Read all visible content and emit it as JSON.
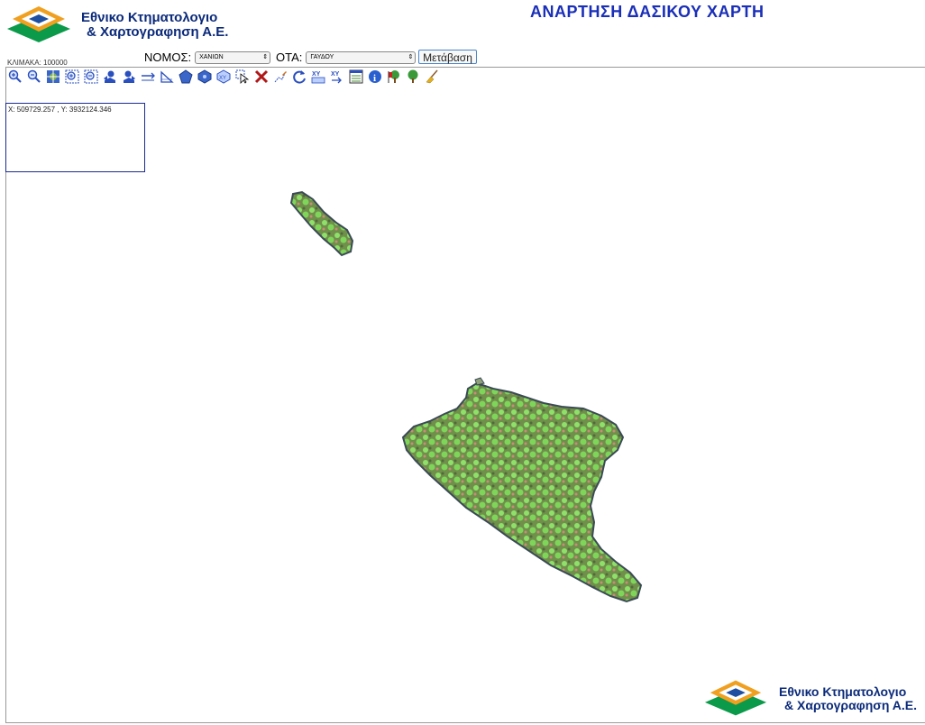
{
  "header": {
    "logo_line1": "Εθνικο Κτηματολογιο",
    "logo_line2": "& Χαρτογραφηση Α.Ε.",
    "title": "ΑΝΑΡΤΗΣΗ ΔΑΣΙΚΟΥ ΧΑΡΤΗ"
  },
  "controls": {
    "scale_label": "ΚΛΙΜΑΚΑ: 100000",
    "nomos_label": "ΝΟΜΟΣ:",
    "nomos_value": "ΧΑΝΙΩΝ",
    "ota_label": "ΟΤΑ:",
    "ota_value": "ΓΑΥΔΟΥ",
    "go_label": "Μετάβαση"
  },
  "toolbar": {
    "tools": [
      {
        "name": "zoom-in-icon"
      },
      {
        "name": "zoom-out-icon"
      },
      {
        "name": "full-extent-icon"
      },
      {
        "name": "zoom-box-in-icon"
      },
      {
        "name": "zoom-box-out-icon"
      },
      {
        "name": "pan-back-icon"
      },
      {
        "name": "pan-forward-icon"
      },
      {
        "name": "measure-distance-icon"
      },
      {
        "name": "measure-angle-icon"
      },
      {
        "name": "polygon-icon"
      },
      {
        "name": "polygon-select-icon"
      },
      {
        "name": "pointer-select-icon"
      },
      {
        "name": "clear-selection-icon"
      },
      {
        "name": "digitize-icon"
      },
      {
        "name": "refresh-icon"
      },
      {
        "name": "xy-goto-icon"
      },
      {
        "name": "xy-locate-icon"
      },
      {
        "name": "legend-icon"
      },
      {
        "name": "info-icon"
      },
      {
        "name": "forest-flag-icon"
      },
      {
        "name": "tree-icon"
      },
      {
        "name": "broom-icon"
      }
    ]
  },
  "map": {
    "coordinates": "X: 509729.257 , Y: 3932124.346"
  }
}
